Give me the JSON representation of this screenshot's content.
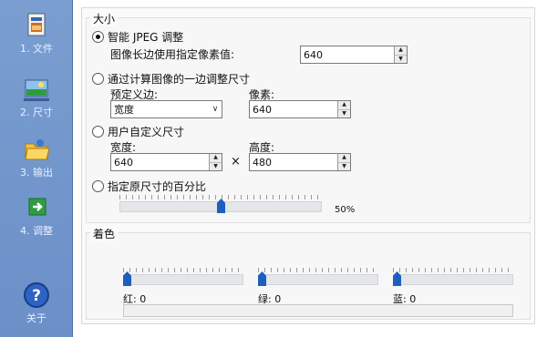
{
  "sidebar": {
    "items": [
      {
        "label": "1. 文件"
      },
      {
        "label": "2. 尺寸"
      },
      {
        "label": "3. 输出"
      },
      {
        "label": "4. 调整"
      },
      {
        "label": "关于"
      }
    ]
  },
  "size_group": {
    "title": "大小",
    "smart": {
      "label": "智能 JPEG 调整",
      "long_edge_label": "图像长边使用指定像素值:",
      "long_edge_value": "640"
    },
    "by_edge": {
      "label": "通过计算图像的一边调整尺寸",
      "preset_label": "预定义边:",
      "preset_value": "宽度",
      "pixels_label": "像素:",
      "pixels_value": "640"
    },
    "custom": {
      "label": "用户自定义尺寸",
      "width_label": "宽度:",
      "width_value": "640",
      "times": "×",
      "height_label": "高度:",
      "height_value": "480"
    },
    "percent": {
      "label": "指定原尺寸的百分比",
      "value_text": "50%",
      "value": 0.5
    }
  },
  "color_group": {
    "title": "着色",
    "red": {
      "label": "红: 0",
      "value": 0
    },
    "green": {
      "label": "绿: 0",
      "value": 0
    },
    "blue": {
      "label": "蓝: 0",
      "value": 0
    }
  }
}
